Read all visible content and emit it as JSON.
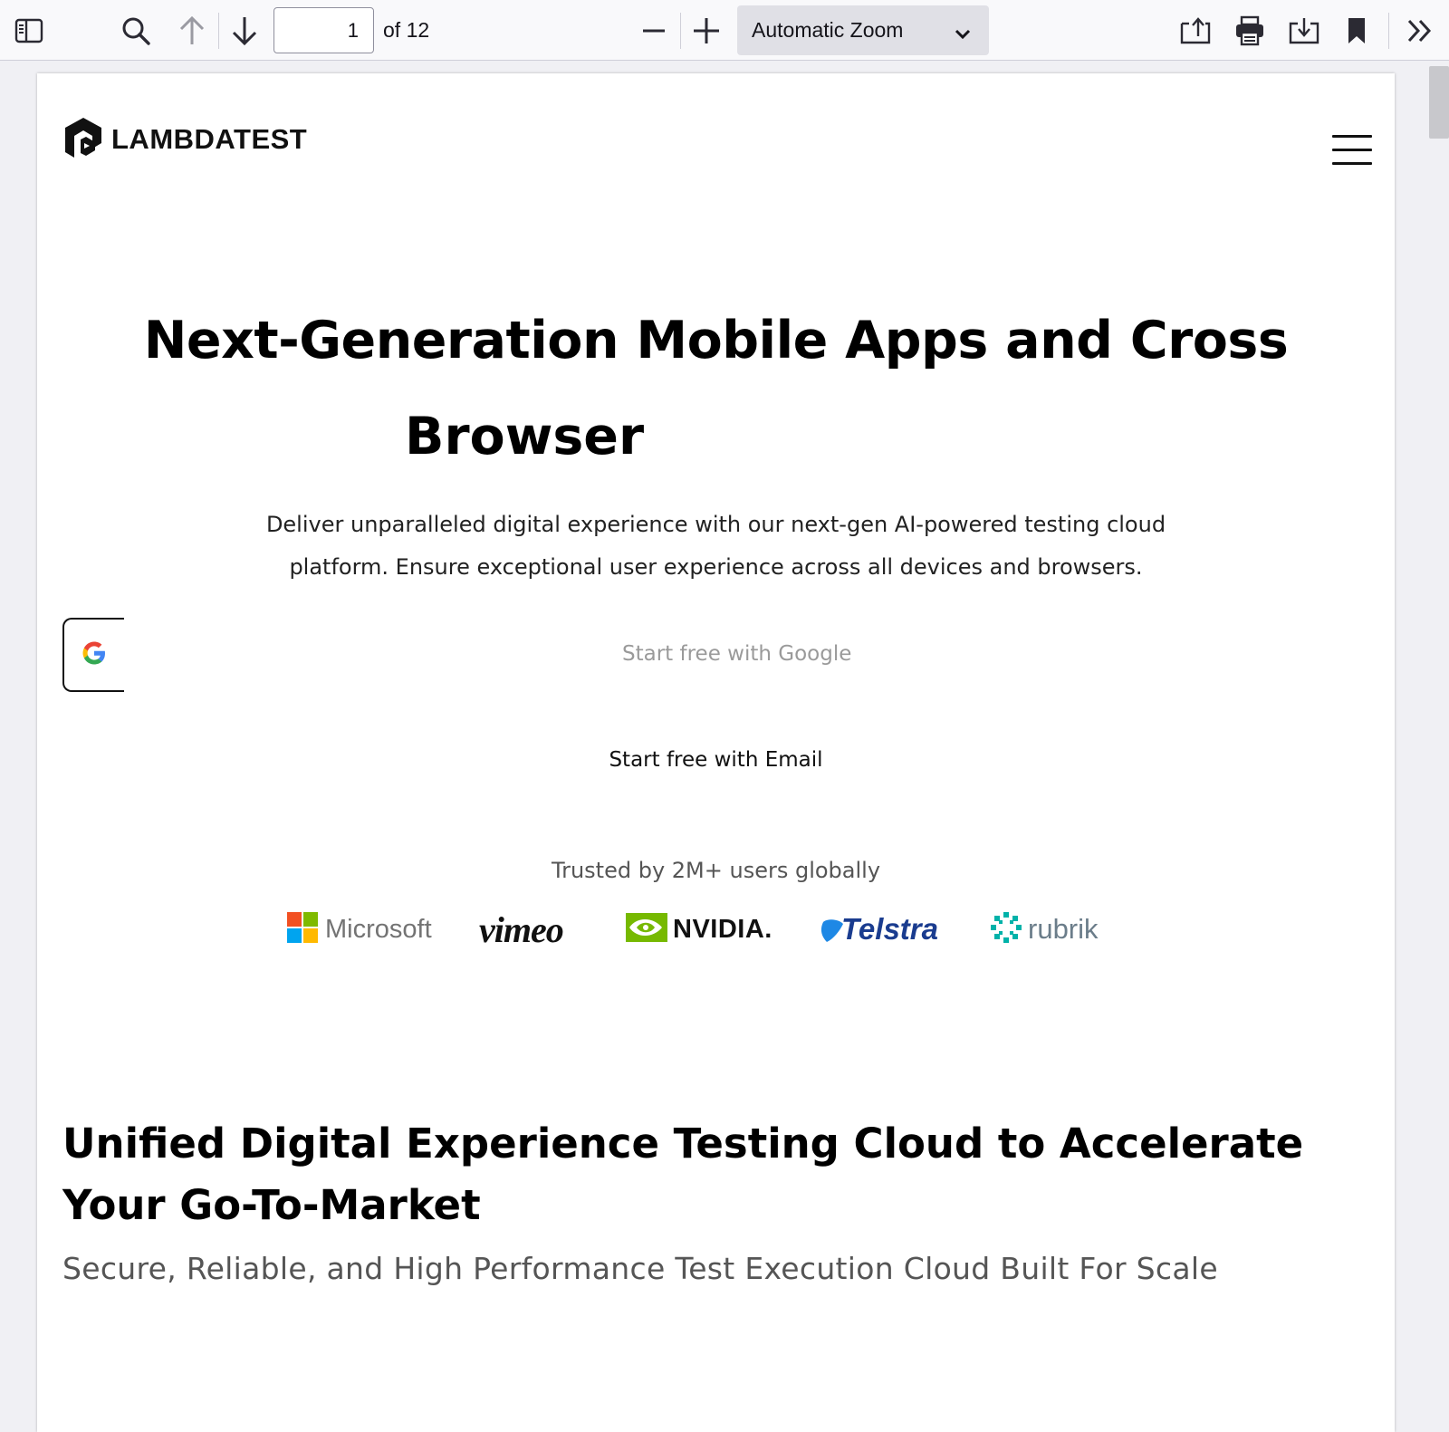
{
  "toolbar": {
    "page_number": "1",
    "page_count": "of 12",
    "zoom_label": "Automatic Zoom"
  },
  "page": {
    "logo_text": "LAMBDATEST",
    "hero_line1": "Next-Generation Mobile Apps and Cross",
    "hero_line2": "Browser",
    "hero_sub_line1": "Deliver unparalleled digital experience with our next-gen AI-powered testing cloud",
    "hero_sub_line2": "platform. Ensure exceptional user experience across all devices and browsers.",
    "google_cta": "Start free with Google",
    "email_cta": "Start free with Email",
    "trusted": "Trusted by 2M+ users globally",
    "brands": {
      "microsoft": "Microsoft",
      "vimeo": "vimeo",
      "nvidia": "NVIDIA.",
      "telstra": "Telstra",
      "rubrik": "rubrik"
    },
    "section_title": "Unified Digital Experience Testing Cloud to Accelerate Your Go-To-Market",
    "section_sub": "Secure, Reliable, and High Performance Test Execution Cloud Built For Scale"
  },
  "icons": {
    "sidebar": "sidebar-toggle-icon",
    "search": "search-icon",
    "prev": "arrow-up-icon",
    "next": "arrow-down-icon",
    "zoom_out": "minus-icon",
    "zoom_in": "plus-icon",
    "open": "open-file-icon",
    "print": "print-icon",
    "download": "download-icon",
    "bookmark": "bookmark-icon",
    "more": "double-chevron-right-icon"
  },
  "colors": {
    "toolbar_bg": "#f9f9fb",
    "viewer_bg": "#f0f0f4",
    "zoom_bg": "#e0e0e6",
    "google_cta_text": "#9a9a9a",
    "telstra_blue": "#1a3c8f",
    "nvidia_green": "#76b900"
  }
}
